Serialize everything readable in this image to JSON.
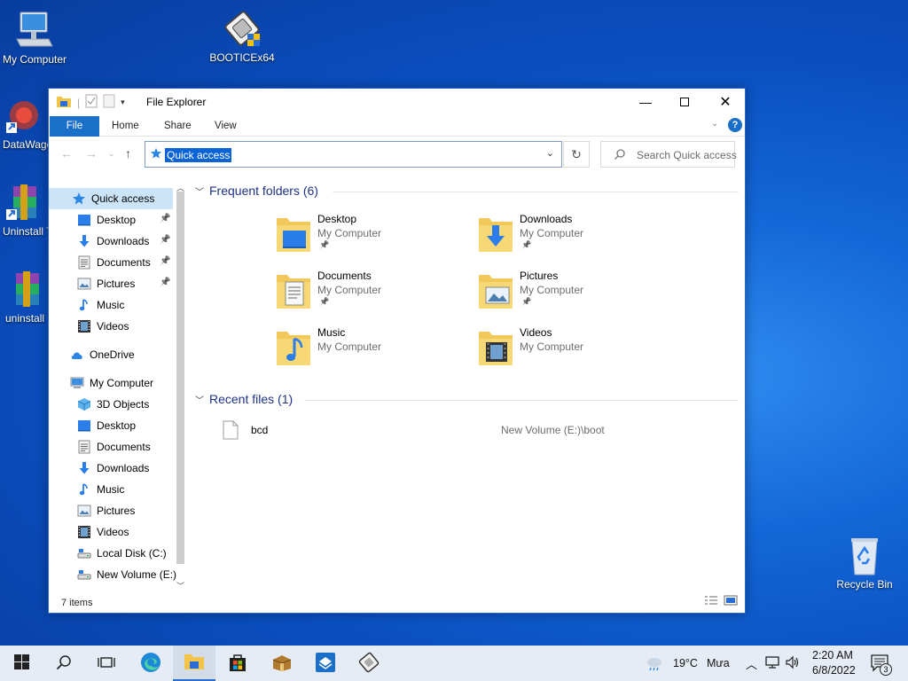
{
  "desktop": {
    "icons": [
      {
        "label": "My Computer"
      },
      {
        "label": "BOOTICEx64"
      },
      {
        "label": "DataWago"
      },
      {
        "label": "Uninstall T"
      },
      {
        "label": "uninstall"
      },
      {
        "label": "Recycle Bin"
      }
    ]
  },
  "window": {
    "title": "File Explorer",
    "ribbon_tabs": [
      "File",
      "Home",
      "Share",
      "View"
    ],
    "address": "Quick access",
    "search_placeholder": "Search Quick access",
    "status": "7 items"
  },
  "sidebar": {
    "items": [
      {
        "label": "Quick access",
        "icon": "star-icon",
        "selected": true
      },
      {
        "label": "Desktop",
        "icon": "desktop-icon",
        "pinned": true
      },
      {
        "label": "Downloads",
        "icon": "download-icon",
        "pinned": true
      },
      {
        "label": "Documents",
        "icon": "documents-icon",
        "pinned": true
      },
      {
        "label": "Pictures",
        "icon": "pictures-icon",
        "pinned": true
      },
      {
        "label": "Music",
        "icon": "music-icon"
      },
      {
        "label": "Videos",
        "icon": "videos-icon"
      },
      {
        "label": "OneDrive",
        "icon": "cloud-icon"
      },
      {
        "label": "My Computer",
        "icon": "computer-icon"
      },
      {
        "label": "3D Objects",
        "icon": "cube-icon"
      },
      {
        "label": "Desktop",
        "icon": "desktop-icon"
      },
      {
        "label": "Documents",
        "icon": "documents-icon"
      },
      {
        "label": "Downloads",
        "icon": "download-icon"
      },
      {
        "label": "Music",
        "icon": "music-icon"
      },
      {
        "label": "Pictures",
        "icon": "pictures-icon"
      },
      {
        "label": "Videos",
        "icon": "videos-icon"
      },
      {
        "label": "Local Disk (C:)",
        "icon": "drive-icon"
      },
      {
        "label": "New Volume (E:)",
        "icon": "drive-icon"
      }
    ]
  },
  "content": {
    "frequent_header": "Frequent folders (6)",
    "folders": [
      {
        "name": "Desktop",
        "location": "My Computer",
        "pinned": true,
        "overlay": "desktop"
      },
      {
        "name": "Downloads",
        "location": "My Computer",
        "pinned": true,
        "overlay": "download"
      },
      {
        "name": "Documents",
        "location": "My Computer",
        "pinned": true,
        "overlay": "documents"
      },
      {
        "name": "Pictures",
        "location": "My Computer",
        "pinned": true,
        "overlay": "pictures"
      },
      {
        "name": "Music",
        "location": "My Computer",
        "pinned": false,
        "overlay": "music"
      },
      {
        "name": "Videos",
        "location": "My Computer",
        "pinned": false,
        "overlay": "videos"
      }
    ],
    "recent_header": "Recent files (1)",
    "recent_files": [
      {
        "name": "bcd",
        "path": "New Volume (E:)\\boot"
      }
    ]
  },
  "taskbar": {
    "temperature": "19°C",
    "weather": "Mưa",
    "time": "2:20 AM",
    "date": "6/8/2022",
    "notifications": "3"
  }
}
